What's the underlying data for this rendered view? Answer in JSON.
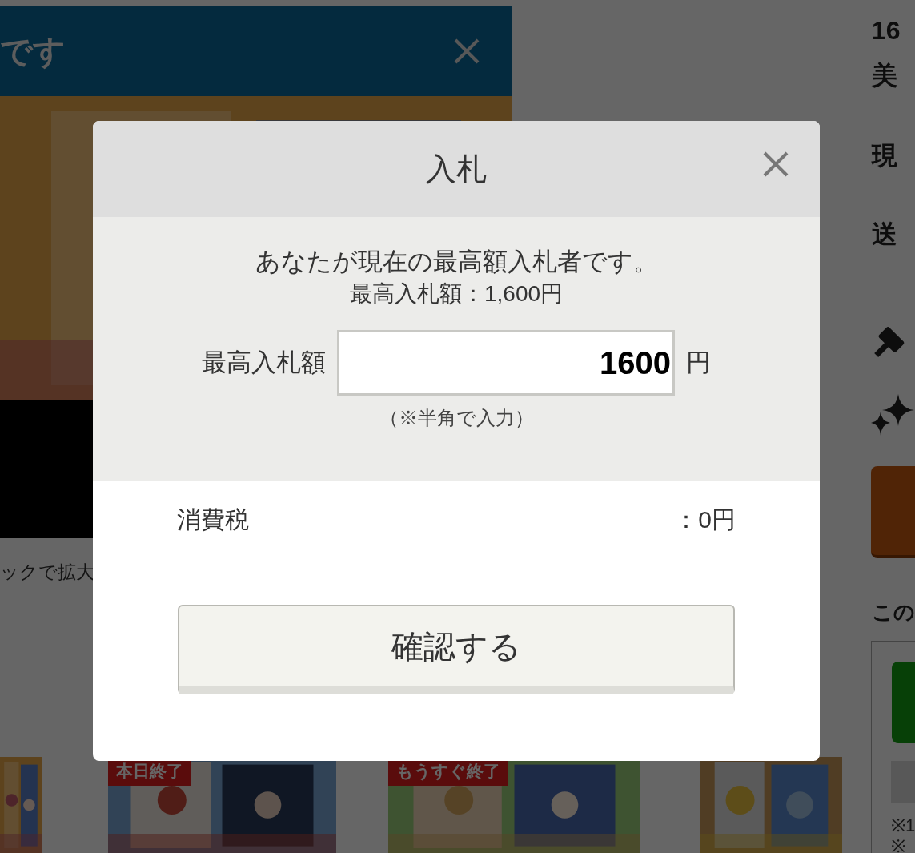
{
  "background_page": {
    "banner": {
      "text": "です"
    },
    "image_caption": "ックで拡大",
    "side_texts": [
      "16",
      "美",
      "現",
      "送"
    ],
    "section_heading": "この",
    "notes": [
      "※1",
      "※"
    ],
    "badges": [
      {
        "text": "本日終了"
      },
      {
        "text": "もうすぐ終了"
      }
    ]
  },
  "dialog": {
    "title": "入札",
    "message": "あなたが現在の最高額入札者です。",
    "current_bid": "最高入札額：1,600円",
    "bid_label": "最高入札額",
    "bid_value": "1600",
    "unit": "円",
    "hint": "（※半角で入力）",
    "tax_label": "消費税",
    "tax_value": "：0円",
    "confirm_button": "確認する"
  }
}
